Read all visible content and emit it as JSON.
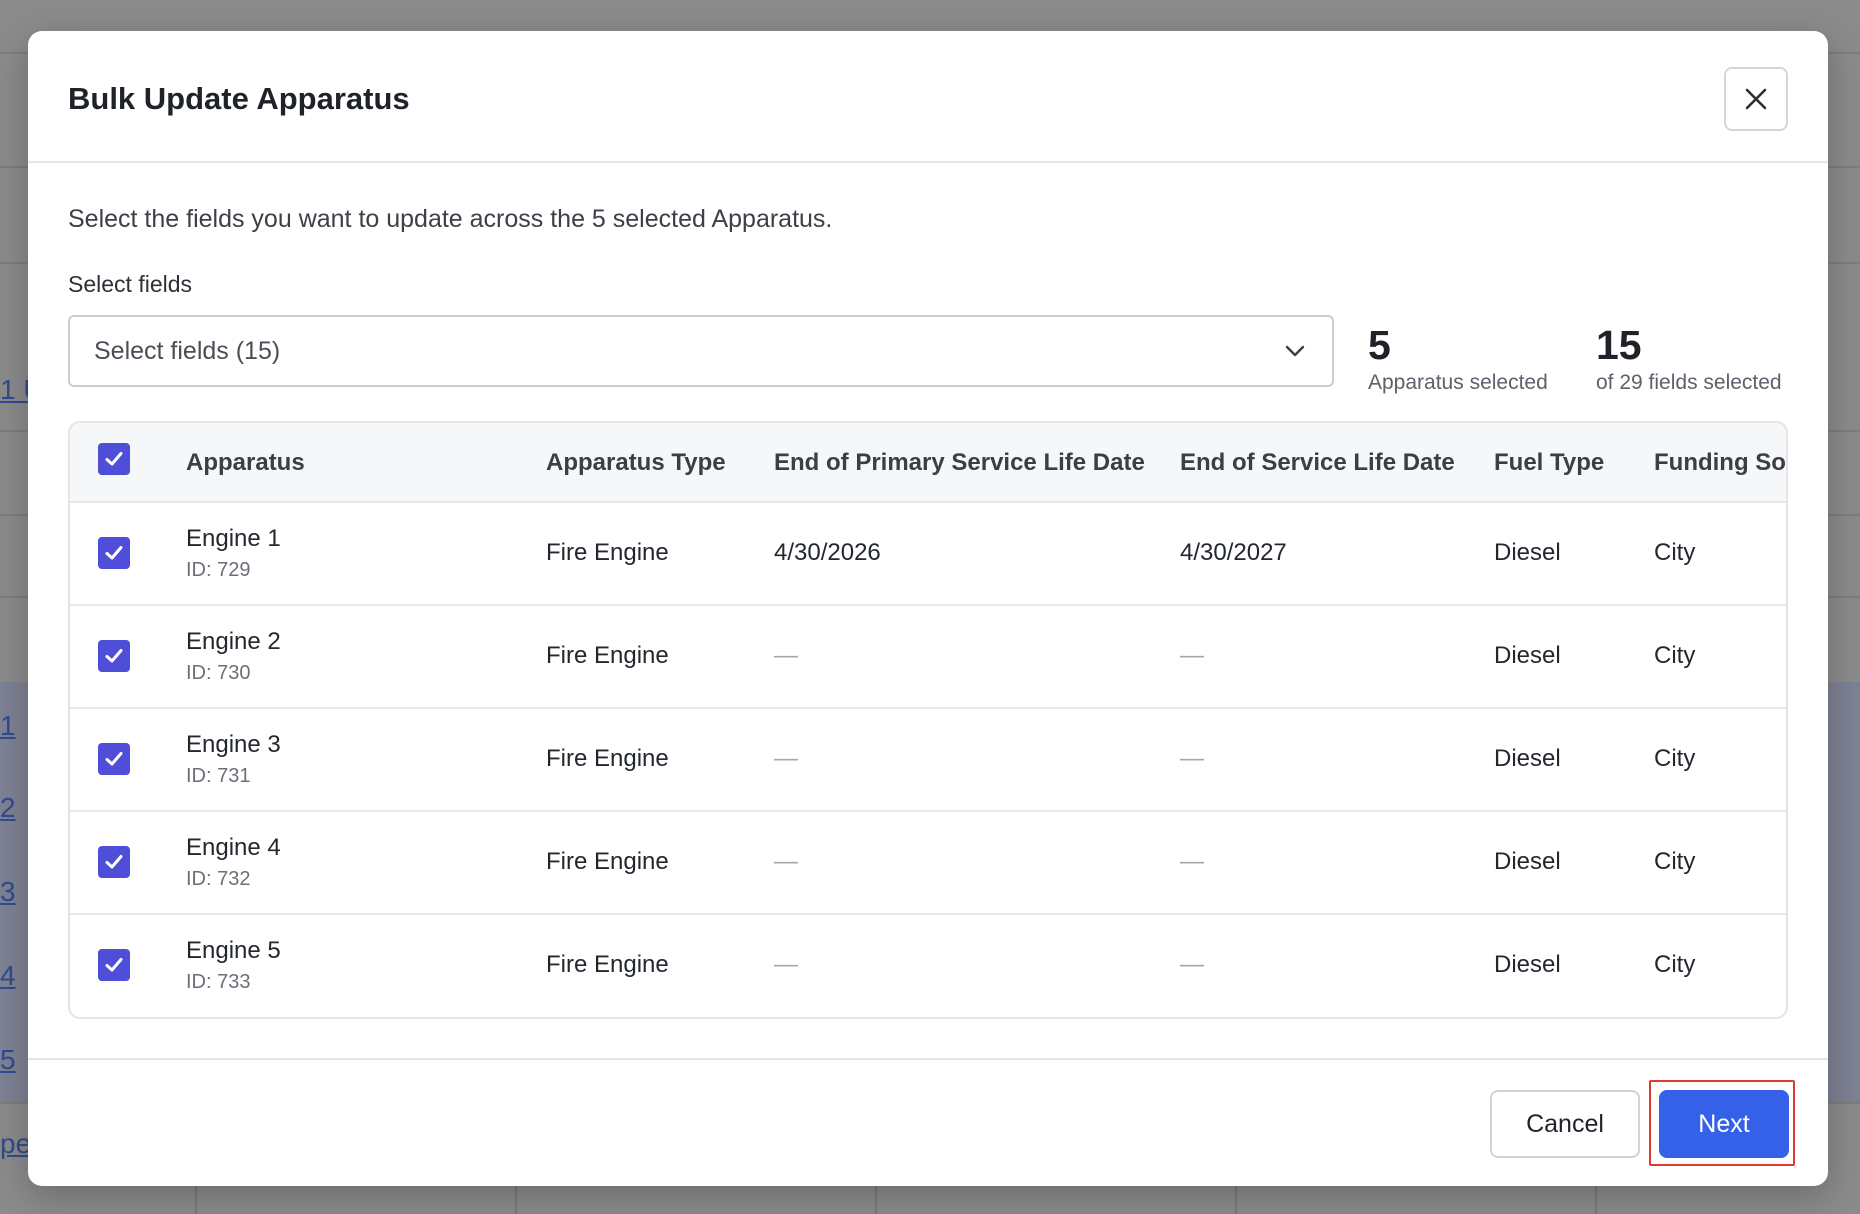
{
  "background": {
    "links": [
      "1 U",
      "1",
      "2",
      "3",
      "4",
      "5",
      "pe"
    ]
  },
  "modal": {
    "title": "Bulk Update Apparatus",
    "close_icon": "close-icon",
    "intro": "Select the fields you want to update across the 5 selected Apparatus.",
    "select_label": "Select fields",
    "select_value": "Select fields (15)",
    "stats": {
      "apparatus_count": "5",
      "apparatus_label": "Apparatus selected",
      "fields_count": "15",
      "fields_label": "of 29 fields selected"
    },
    "table": {
      "headers": [
        "Apparatus",
        "Apparatus Type",
        "End of Primary Service Life Date",
        "End of Service Life Date",
        "Fuel Type",
        "Funding Sou"
      ],
      "rows": [
        {
          "name": "Engine 1",
          "id": "ID: 729",
          "type": "Fire Engine",
          "primary_end": "4/30/2026",
          "service_end": "4/30/2027",
          "fuel": "Diesel",
          "funding": "City"
        },
        {
          "name": "Engine 2",
          "id": "ID: 730",
          "type": "Fire Engine",
          "primary_end": "—",
          "service_end": "—",
          "fuel": "Diesel",
          "funding": "City"
        },
        {
          "name": "Engine 3",
          "id": "ID: 731",
          "type": "Fire Engine",
          "primary_end": "—",
          "service_end": "—",
          "fuel": "Diesel",
          "funding": "City"
        },
        {
          "name": "Engine 4",
          "id": "ID: 732",
          "type": "Fire Engine",
          "primary_end": "—",
          "service_end": "—",
          "fuel": "Diesel",
          "funding": "City"
        },
        {
          "name": "Engine 5",
          "id": "ID: 733",
          "type": "Fire Engine",
          "primary_end": "—",
          "service_end": "—",
          "fuel": "Diesel",
          "funding": "City"
        }
      ]
    },
    "footer": {
      "cancel_label": "Cancel",
      "next_label": "Next"
    }
  },
  "colors": {
    "accent": "#3461e8",
    "checkbox": "#4f4ed8",
    "highlight": "#e0392f"
  }
}
